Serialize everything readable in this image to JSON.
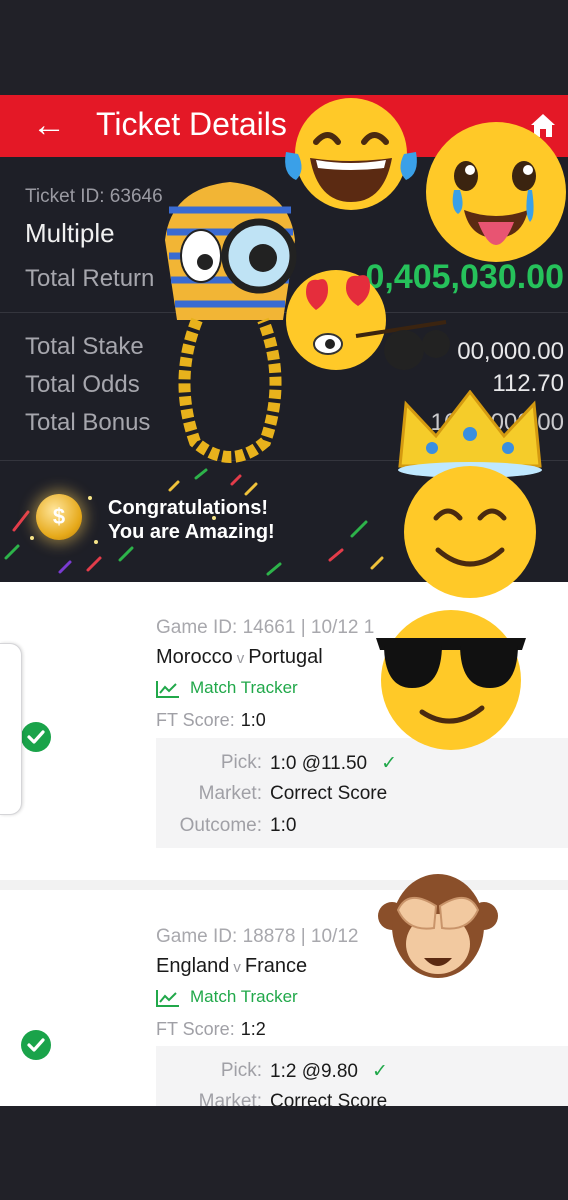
{
  "header": {
    "back_icon": "arrow-left-icon",
    "title": "Ticket Details",
    "home_icon": "home-icon",
    "accent": "#e41826"
  },
  "summary": {
    "ticket_id": "Ticket ID: 63646",
    "type": "Multiple",
    "total_return_label": "Total Return",
    "total_return_value": "0,405,030.00",
    "total_stake_label": "Total Stake",
    "total_stake_value": "00,000.00",
    "total_odds_label": "Total Odds",
    "total_odds_value": "112.70",
    "total_bonus_label": "Total Bonus",
    "total_bonus_value": "1690,000.00"
  },
  "congrats": {
    "line1": "Congratulations!",
    "line2": "You are Amazing!",
    "coin_icon": "coin-icon"
  },
  "games": [
    {
      "game_id": "Game ID: 14661 | 10/12 1",
      "home": "Morocco",
      "vs": "v",
      "away": "Portugal",
      "tracker": "Match Tracker",
      "ft_label": "FT Score:",
      "ft_value": "1:0",
      "pick_label": "Pick:",
      "pick_value": "1:0 @11.50",
      "market_label": "Market:",
      "market_value": "Correct Score",
      "outcome_label": "Outcome:",
      "outcome_value": "1:0"
    },
    {
      "game_id": "Game ID: 18878 | 10/12",
      "home": "England",
      "vs": "v",
      "away": "France",
      "tracker": "Match Tracker",
      "ft_label": "FT Score:",
      "ft_value": "1:2",
      "pick_label": "Pick:",
      "pick_value": "1:2 @9.80",
      "market_label": "Market:",
      "market_value": "Correct Score"
    }
  ],
  "stickers": [
    "laughing-tears-emoji",
    "tongue-out-tears-emoji",
    "pharaoh-magnifier-emoji",
    "heart-eyes-emoji",
    "crown-smile-emoji",
    "sunglasses-emoji",
    "see-no-evil-monkey-emoji"
  ],
  "colors": {
    "win_green": "#26c25b",
    "check_green": "#1aa34a",
    "dark_bg": "#1e1f27"
  }
}
